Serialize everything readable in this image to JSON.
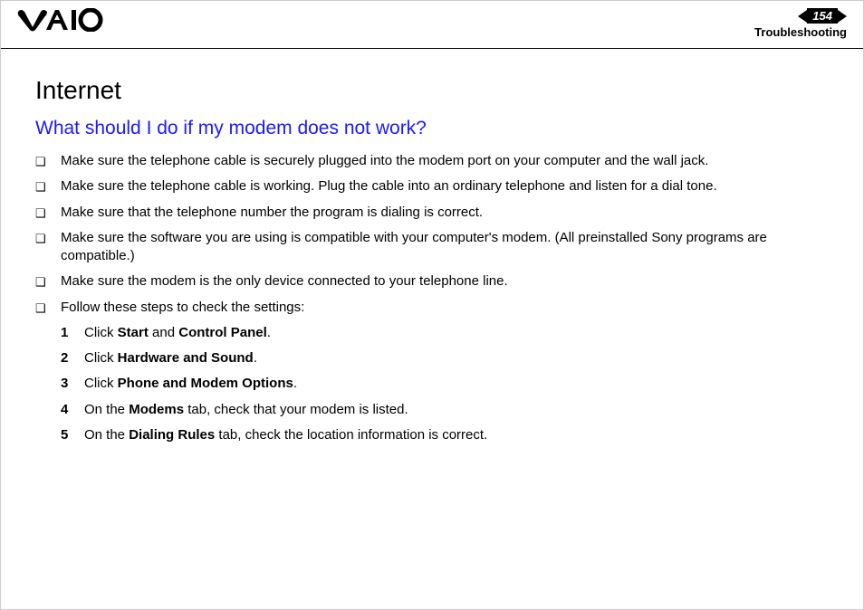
{
  "header": {
    "page_number": "154",
    "section": "Troubleshooting"
  },
  "content": {
    "heading": "Internet",
    "subheading": "What should I do if my modem does not work?",
    "bullets": [
      "Make sure the telephone cable is securely plugged into the modem port on your computer and the wall jack.",
      "Make sure the telephone cable is working. Plug the cable into an ordinary telephone and listen for a dial tone.",
      "Make sure that the telephone number the program is dialing is correct.",
      "Make sure the software you are using is compatible with your computer's modem. (All preinstalled Sony programs are compatible.)",
      "Make sure the modem is the only device connected to your telephone line.",
      "Follow these steps to check the settings:"
    ],
    "steps": [
      {
        "n": "1",
        "pre": "Click ",
        "bold": [
          "Start",
          "Control Panel"
        ],
        "joiner": " and ",
        "post": "."
      },
      {
        "n": "2",
        "pre": "Click ",
        "bold": [
          "Hardware and Sound"
        ],
        "joiner": "",
        "post": "."
      },
      {
        "n": "3",
        "pre": "Click ",
        "bold": [
          "Phone and Modem Options"
        ],
        "joiner": "",
        "post": "."
      },
      {
        "n": "4",
        "pre": "On the ",
        "bold": [
          "Modems"
        ],
        "joiner": "",
        "post": " tab, check that your modem is listed."
      },
      {
        "n": "5",
        "pre": "On the ",
        "bold": [
          "Dialing Rules"
        ],
        "joiner": "",
        "post": " tab, check the location information is correct."
      }
    ]
  }
}
